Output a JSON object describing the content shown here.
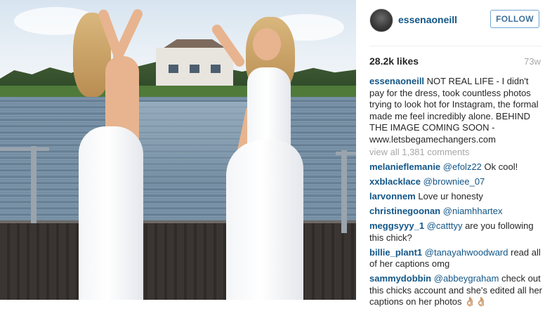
{
  "post": {
    "username": "essenaoneill",
    "follow_label": "FOLLOW",
    "likes": "28.2k likes",
    "age": "73w",
    "caption": {
      "username": "essenaoneill",
      "text": "NOT REAL LIFE - I didn't pay for the dress, took countless photos trying to look hot for Instagram, the formal made me feel incredibly alone. BEHIND THE IMAGE COMING SOON - www.letsbegamechangers.com"
    },
    "view_all": "view all 1,381 comments",
    "comments": [
      {
        "user": "melanieflemanie",
        "mention": "@efolz22",
        "text": "Ok cool!"
      },
      {
        "user": "xxblacklace",
        "mention": "@browniee_07",
        "text": ""
      },
      {
        "user": "larvonnem",
        "mention": "",
        "text": "Love ur honesty"
      },
      {
        "user": "christinegoonan",
        "mention": "@niamhhartex",
        "text": ""
      },
      {
        "user": "meggsyyy_1",
        "mention": "@catttyy",
        "text": "are you following this chick?"
      },
      {
        "user": "billie_plant1",
        "mention": "@tanayahwoodward",
        "text": "read all of her captions omg"
      },
      {
        "user": "sammydobbin",
        "mention": "@abbeygraham",
        "text": "check out this chicks account and she's edited all her captions on her photos 👌🏼👌🏼"
      }
    ]
  },
  "colors": {
    "link": "#125688",
    "follow_border": "#70a6d4",
    "muted": "#a5a7aa",
    "text": "#262626"
  },
  "icons": {
    "avatar": "profile-avatar"
  }
}
